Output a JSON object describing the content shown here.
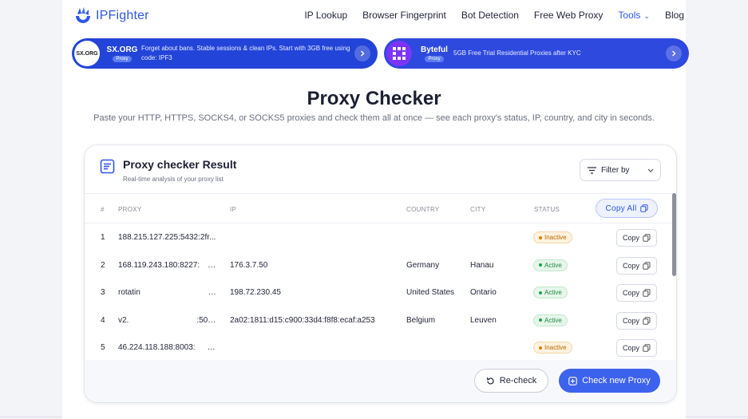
{
  "brand": {
    "name": "IPFighter"
  },
  "nav": {
    "links": [
      {
        "label": "IP Lookup"
      },
      {
        "label": "Browser Fingerprint"
      },
      {
        "label": "Bot Detection"
      },
      {
        "label": "Free Web Proxy"
      },
      {
        "label": "Tools"
      },
      {
        "label": "Blog"
      }
    ]
  },
  "banners": [
    {
      "logo_text": "SX.ORG",
      "name": "SX.ORG",
      "tag": "Proxy",
      "text": "Forget about bans. Stable sessions & clean IPs. Start with 3GB free using code: IPF3"
    },
    {
      "name": "Byteful",
      "tag": "Proxy",
      "text": "5GB Free Trial Residential Proxies after KYC"
    }
  ],
  "page": {
    "title": "Proxy Checker",
    "subtitle": "Paste your HTTP, HTTPS, SOCKS4, or SOCKS5 proxies and check them all at once — see each proxy's status, IP, country, and city in seconds."
  },
  "card": {
    "title": "Proxy checker Result",
    "subtitle": "Real-time analysis of your proxy list",
    "filter_label": "Filter by",
    "columns": {
      "num": "#",
      "proxy": "PROXY",
      "ip": "IP",
      "country": "COUNTRY",
      "city": "CITY",
      "status": "STATUS"
    },
    "copy_all_label": "Copy All",
    "copy_label": "Copy",
    "rows": [
      {
        "num": "1",
        "proxy": "188.215.127.225:5432:2fr...",
        "ip": "",
        "country": "",
        "city": "",
        "status": "Inactive"
      },
      {
        "num": "2",
        "proxy": "168.119.243.180:8227:      ...",
        "ip": "176.3.7.50",
        "country": "Germany",
        "city": "Hanau",
        "status": "Active"
      },
      {
        "num": "3",
        "proxy": "rotatin                 co...",
        "ip": "198.72.230.45",
        "country": "United States",
        "city": "Ontario",
        "status": "Active"
      },
      {
        "num": "4",
        "proxy": "v2.                 :500...",
        "ip": "2a02:1811:d15:c900:33d4:f8f8:ecaf:a253",
        "country": "Belgium",
        "city": "Leuven",
        "status": "Active"
      },
      {
        "num": "5",
        "proxy": "46.224.118.188:8003:      ...",
        "ip": "",
        "country": "",
        "city": "",
        "status": "Inactive"
      }
    ],
    "recheck_label": "Re-check",
    "check_new_label": "Check new Proxy"
  },
  "colors": {
    "accent": "#2f56e6",
    "banner": "#2344d8",
    "active": "#1f8a42",
    "inactive": "#b86a00"
  }
}
